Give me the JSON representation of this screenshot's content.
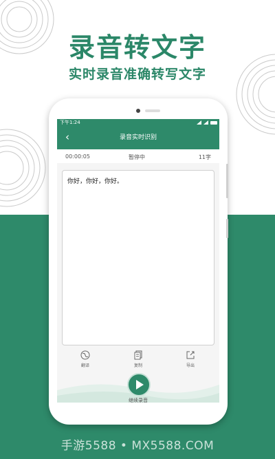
{
  "hero": {
    "title": "录音转文字",
    "subtitle": "实时录音准确转写文字"
  },
  "phone": {
    "status_bar": {
      "time": "下午1:24"
    },
    "app_bar": {
      "title": "录音实时识别",
      "back_icon": "chevron-left-icon"
    },
    "info": {
      "elapsed": "00:00:05",
      "state": "暂停中",
      "char_count": "11字"
    },
    "transcript": "你好，你好，你好。",
    "tools": [
      {
        "label": "翻译",
        "icon": "translate-icon"
      },
      {
        "label": "复制",
        "icon": "copy-icon"
      },
      {
        "label": "导出",
        "icon": "export-icon"
      }
    ],
    "record_button": {
      "label": "继续录音",
      "icon": "play-icon"
    }
  },
  "watermark": "手游5588 • MX5588.COM",
  "colors": {
    "brand_green": "#2e8a6a",
    "title_green": "#2b8768"
  }
}
